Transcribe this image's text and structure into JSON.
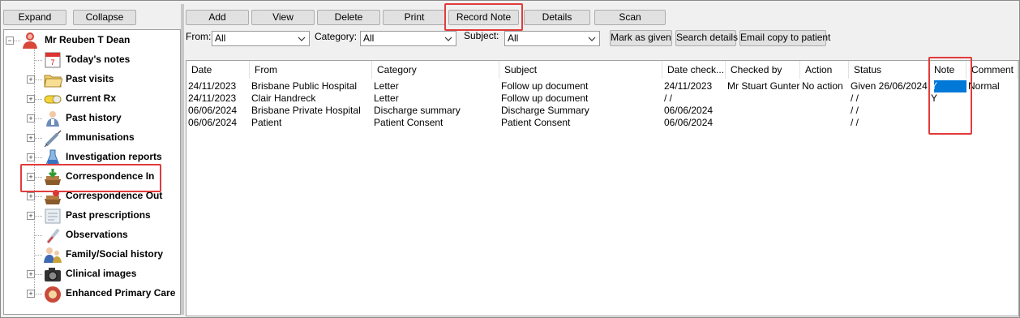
{
  "tree_buttons": {
    "expand": "Expand",
    "collapse": "Collapse"
  },
  "patient": {
    "name": "Mr Reuben T Dean"
  },
  "tree_items": [
    {
      "label": "Today's notes",
      "icon": "calendar-icon"
    },
    {
      "label": "Past visits",
      "icon": "folder-icon"
    },
    {
      "label": "Current Rx",
      "icon": "pill-icon"
    },
    {
      "label": "Past history",
      "icon": "doctor-icon"
    },
    {
      "label": "Immunisations",
      "icon": "syringe-icon"
    },
    {
      "label": "Investigation reports",
      "icon": "flask-icon"
    },
    {
      "label": "Correspondence In",
      "icon": "inbox-tray-icon"
    },
    {
      "label": "Correspondence Out",
      "icon": "outbox-tray-icon"
    },
    {
      "label": "Past prescriptions",
      "icon": "prescription-icon"
    },
    {
      "label": "Observations",
      "icon": "thermometer-icon"
    },
    {
      "label": "Family/Social history",
      "icon": "family-icon"
    },
    {
      "label": "Clinical images",
      "icon": "camera-icon"
    },
    {
      "label": "Enhanced Primary Care",
      "icon": "epc-icon"
    }
  ],
  "toolbar": {
    "add": "Add",
    "view": "View",
    "delete": "Delete",
    "print": "Print",
    "record_note": "Record Note",
    "details": "Details",
    "scan": "Scan"
  },
  "filters": {
    "from_label": "From:",
    "from_value": "All",
    "category_label": "Category:",
    "category_value": "All",
    "subject_label": "Subject:",
    "subject_value": "All",
    "mark_as_given": "Mark as given",
    "search_details": "Search details",
    "email_copy": "Email copy to patient"
  },
  "table": {
    "columns": [
      "Date",
      "From",
      "Category",
      "Subject",
      "Date check...",
      "Checked by",
      "Action",
      "Status",
      "Note",
      "Comment"
    ],
    "rows": [
      [
        "24/11/2023",
        "Brisbane Public Hospital",
        "Letter",
        "Follow up document",
        "24/11/2023",
        "Mr Stuart Gunter",
        "No action",
        "Given 26/06/2024",
        "Y",
        "Normal"
      ],
      [
        "24/11/2023",
        "Clair Handreck",
        "Letter",
        "Follow up document",
        " / /",
        "",
        "",
        " / /",
        "Y",
        ""
      ],
      [
        "06/06/2024",
        "Brisbane Private Hospital",
        "Discharge summary",
        "Discharge Summary",
        "06/06/2024",
        "",
        "",
        " / /",
        "",
        ""
      ],
      [
        "06/06/2024",
        "Patient",
        "Patient Consent",
        "Patient Consent",
        "06/06/2024",
        "",
        "",
        " / /",
        "",
        ""
      ]
    ]
  },
  "colors": {
    "highlight": "#e23b3b",
    "selection": "#0078d7"
  }
}
